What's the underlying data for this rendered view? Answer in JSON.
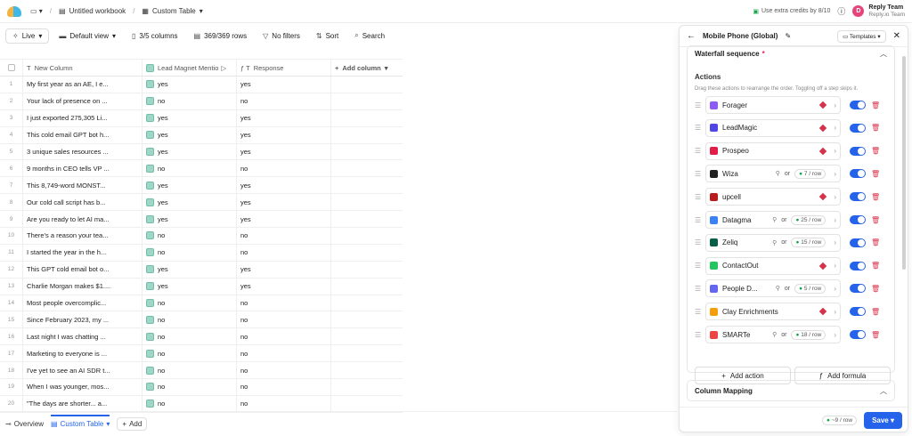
{
  "topbar": {
    "workbook": "Untitled workbook",
    "table": "Custom Table",
    "credits": "Use extra credits by 8/10",
    "team_avatar": "D",
    "team_name": "Reply Team",
    "team_sub": "Reply.io Team"
  },
  "toolbar": {
    "live": "Live",
    "view": "Default view",
    "columns": "3/5 columns",
    "rows": "369/369 rows",
    "filters": "No filters",
    "sort": "Sort",
    "search": "Search"
  },
  "table": {
    "headers": [
      "New Column",
      "Lead Magnet Mentio",
      "Response",
      "Add column"
    ],
    "rows": [
      {
        "n": "1",
        "text": "My first year as an AE, I e...",
        "lm": "yes",
        "resp": "yes"
      },
      {
        "n": "2",
        "text": "Your lack of presence on ...",
        "lm": "no",
        "resp": "no"
      },
      {
        "n": "3",
        "text": "I just exported 275,305 Li...",
        "lm": "yes",
        "resp": "yes"
      },
      {
        "n": "4",
        "text": "This cold email GPT bot h...",
        "lm": "yes",
        "resp": "yes"
      },
      {
        "n": "5",
        "text": "3 unique sales resources ...",
        "lm": "yes",
        "resp": "yes"
      },
      {
        "n": "6",
        "text": "9 months in CEO tells VP ...",
        "lm": "no",
        "resp": "no"
      },
      {
        "n": "7",
        "text": "This 8,749-word MONST...",
        "lm": "yes",
        "resp": "yes"
      },
      {
        "n": "8",
        "text": "Our cold call script has b...",
        "lm": "yes",
        "resp": "yes"
      },
      {
        "n": "9",
        "text": "Are you ready to let AI ma...",
        "lm": "yes",
        "resp": "yes"
      },
      {
        "n": "10",
        "text": "There's a reason your tea...",
        "lm": "no",
        "resp": "no"
      },
      {
        "n": "11",
        "text": "I started the year in the h...",
        "lm": "no",
        "resp": "no"
      },
      {
        "n": "12",
        "text": "This GPT cold email bot o...",
        "lm": "yes",
        "resp": "yes"
      },
      {
        "n": "13",
        "text": "Charlie Morgan makes $1....",
        "lm": "yes",
        "resp": "yes"
      },
      {
        "n": "14",
        "text": "Most people overcomplic...",
        "lm": "no",
        "resp": "no"
      },
      {
        "n": "15",
        "text": "Since February 2023, my ...",
        "lm": "no",
        "resp": "no"
      },
      {
        "n": "16",
        "text": "Last night I was chatting ...",
        "lm": "no",
        "resp": "no"
      },
      {
        "n": "17",
        "text": "Marketing to everyone is ...",
        "lm": "no",
        "resp": "no"
      },
      {
        "n": "18",
        "text": "I've yet to see an AI SDR t...",
        "lm": "no",
        "resp": "no"
      },
      {
        "n": "19",
        "text": "When I was younger, mos...",
        "lm": "no",
        "resp": "no"
      },
      {
        "n": "20",
        "text": "\"The days are shorter... a...",
        "lm": "no",
        "resp": "no"
      }
    ]
  },
  "bottombar": {
    "overview": "Overview",
    "custom_table": "Custom Table",
    "add": "Add"
  },
  "panel": {
    "title": "Mobile Phone (Global)",
    "templates": "Templates",
    "waterfall_title": "Waterfall sequence",
    "required_mark": "*",
    "actions_label": "Actions",
    "actions_sub": "Drag these actions to rearrange the order. Toggling off a step skips it.",
    "or_label": "or",
    "actions": [
      {
        "name": "Forager",
        "type": "diamond",
        "color": "#8b5cf6"
      },
      {
        "name": "LeadMagic",
        "type": "diamond",
        "color": "#4f46e5"
      },
      {
        "name": "Prospeo",
        "type": "diamond",
        "color": "#e11d48"
      },
      {
        "name": "Wiza",
        "type": "credit",
        "credit": "7 / row",
        "color": "#222222"
      },
      {
        "name": "upcell",
        "type": "diamond",
        "color": "#b91c1c"
      },
      {
        "name": "Datagma",
        "type": "credit",
        "credit": "25 / row",
        "color": "#3b82f6"
      },
      {
        "name": "Zeliq",
        "type": "credit",
        "credit": "15 / row",
        "color": "#065f46"
      },
      {
        "name": "ContactOut",
        "type": "diamond",
        "color": "#22c55e"
      },
      {
        "name": "People D...",
        "type": "credit",
        "credit": "5 / row",
        "color": "#6366f1"
      },
      {
        "name": "Clay Enrichments",
        "type": "diamond",
        "color": "#f59e0b"
      },
      {
        "name": "SMARTe",
        "type": "credit",
        "credit": "18 / row",
        "color": "#ef4444"
      }
    ],
    "add_action": "Add action",
    "add_formula": "Add formula",
    "column_mapping": "Column Mapping",
    "cost": "~9 / row",
    "save": "Save"
  }
}
